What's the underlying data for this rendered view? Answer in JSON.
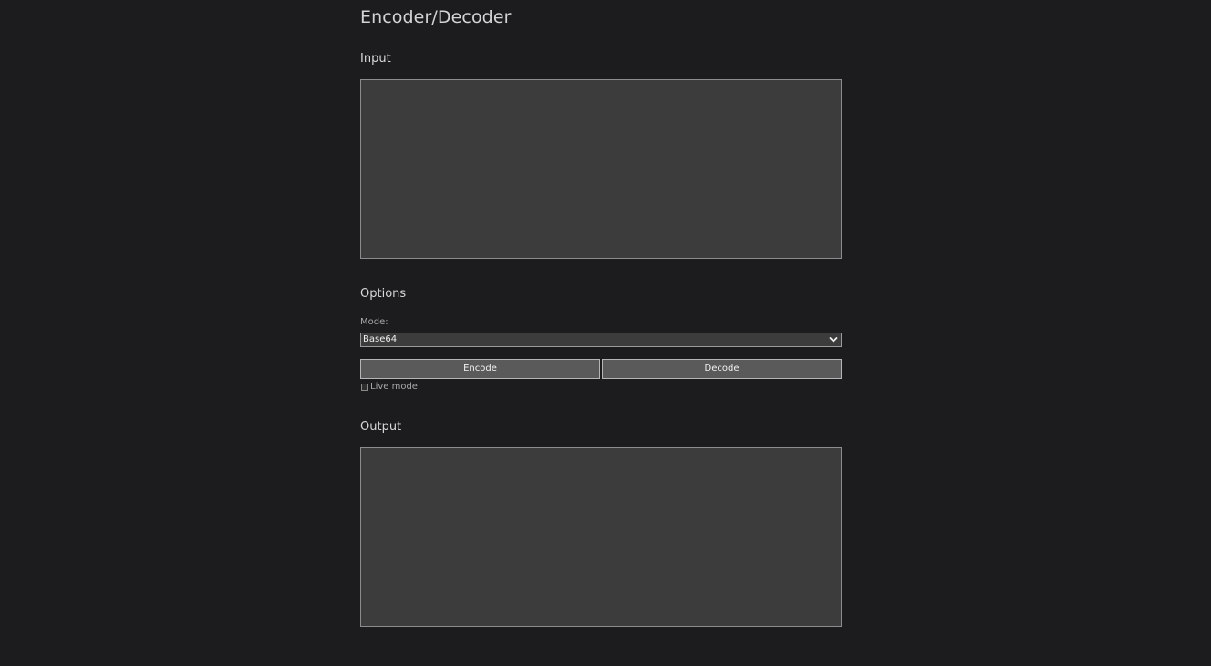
{
  "page": {
    "title": "Encoder/Decoder"
  },
  "input_section": {
    "heading": "Input",
    "value": ""
  },
  "options_section": {
    "heading": "Options",
    "mode_label": "Mode:",
    "mode_selected": "Base64",
    "encode_label": "Encode",
    "decode_label": "Decode",
    "live_mode_label": "Live mode",
    "live_mode_checked": false
  },
  "output_section": {
    "heading": "Output",
    "value": ""
  },
  "colors": {
    "background": "#1c1c1e",
    "field_background": "#3c3c3c",
    "field_border": "#8c8c8c",
    "button_background": "#5a5a5a",
    "text": "#d6d6d6"
  },
  "icons": {
    "select_arrow": "chevron-down-icon"
  }
}
